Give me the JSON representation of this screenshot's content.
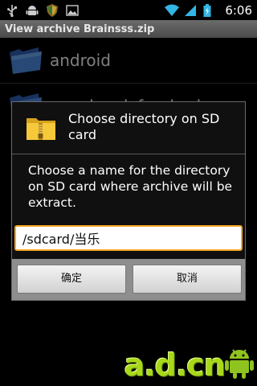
{
  "status_bar": {
    "time": "6:06",
    "left_icons": [
      "usb-icon",
      "android-debug-icon",
      "shield-icon",
      "image-icon"
    ],
    "right_icons": [
      "wifi-icon",
      "signal-icon",
      "battery-icon"
    ]
  },
  "title_bar": {
    "title": "View archive Brainsss.zip"
  },
  "file_list": [
    {
      "label": "android",
      "icon": "folder-icon"
    },
    {
      "label": "com.lonelyfew.brainsss",
      "icon": "folder-icon"
    }
  ],
  "dialog": {
    "title": "Choose directory on SD card",
    "message": "Choose a name for the directory on SD card where archive will be extract.",
    "input_value": "/sdcard/当乐",
    "ok_label": "确定",
    "cancel_label": "取消",
    "icon": "zip-folder-icon"
  },
  "watermark": {
    "text": "a.d.cn"
  },
  "colors": {
    "input_border": "#f6a623",
    "watermark": "#a8d81a",
    "folder_blue": "#3b6fc8"
  }
}
